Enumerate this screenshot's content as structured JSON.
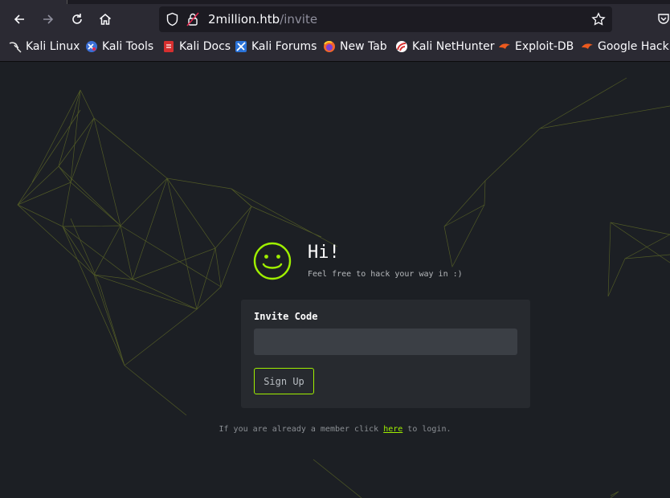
{
  "browser": {
    "url_host": "2million.htb",
    "url_path": "/invite",
    "bookmarks": [
      {
        "label": "Kali Linux",
        "icon": "kali-dragon-icon"
      },
      {
        "label": "Kali Tools",
        "icon": "kali-tools-icon"
      },
      {
        "label": "Kali Docs",
        "icon": "kali-docs-icon"
      },
      {
        "label": "Kali Forums",
        "icon": "kali-forums-icon"
      },
      {
        "label": "New Tab",
        "icon": "firefox-icon"
      },
      {
        "label": "Kali NetHunter",
        "icon": "nethunter-icon"
      },
      {
        "label": "Exploit-DB",
        "icon": "exploit-db-icon"
      },
      {
        "label": "Google Hackin",
        "icon": "ghdb-icon"
      }
    ]
  },
  "page": {
    "greeting": "Hi!",
    "tagline": "Feel free to hack your way in :)",
    "form": {
      "invite_label": "Invite Code",
      "invite_value": "",
      "signup_label": "Sign Up"
    },
    "footer": {
      "prefix": "If you are already a member click ",
      "link": "here",
      "suffix": " to login."
    }
  },
  "colors": {
    "accent": "#9fef00",
    "background": "#1c1f24",
    "card": "#272a2f",
    "input": "#3b3f45"
  }
}
